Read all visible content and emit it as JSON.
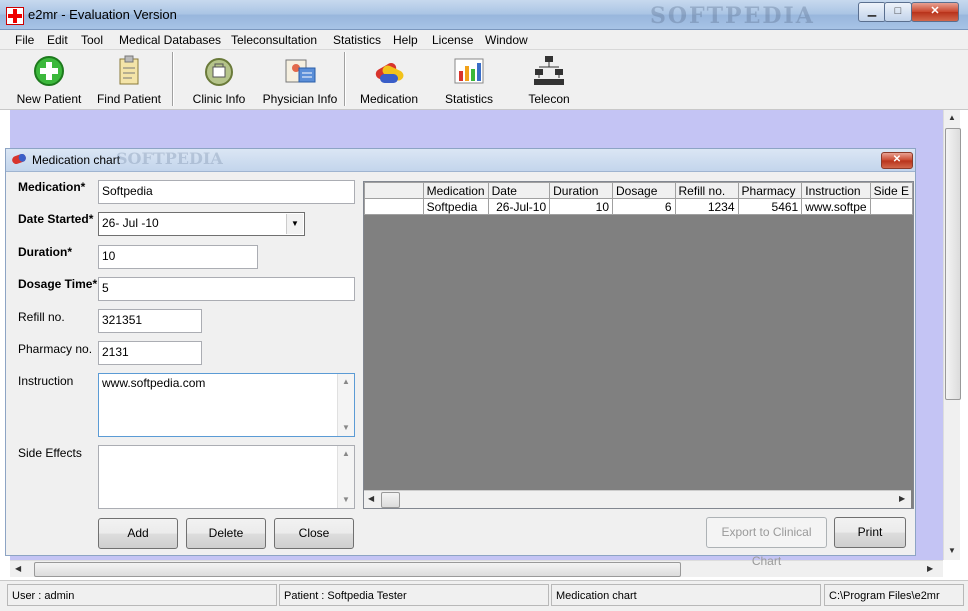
{
  "window": {
    "title": "e2mr - Evaluation Version",
    "watermark": "SOFTPEDIA",
    "min_glyph": "▁",
    "max_glyph": "□",
    "close_glyph": "✕"
  },
  "menu": [
    "File",
    "Edit",
    "Tool",
    "Medical Databases",
    "Teleconsultation",
    "Statistics",
    "Help",
    "License",
    "Window"
  ],
  "toolbar": [
    {
      "label": "New Patient",
      "icon": "new-patient-icon"
    },
    {
      "label": "Find Patient",
      "icon": "find-patient-icon"
    },
    {
      "label": "Clinic Info",
      "icon": "clinic-info-icon"
    },
    {
      "label": "Physician Info",
      "icon": "physician-info-icon"
    },
    {
      "label": "Medication",
      "icon": "medication-icon"
    },
    {
      "label": "Statistics",
      "icon": "statistics-icon"
    },
    {
      "label": "Telecon",
      "icon": "telecon-icon"
    }
  ],
  "child": {
    "title": "Medication chart",
    "watermark": "SOFTPEDIA",
    "close_glyph": "✕",
    "form": {
      "medication_label": "Medication*",
      "medication_value": "Softpedia",
      "date_label": "Date Started*",
      "date_value": "26- Jul -10",
      "duration_label": "Duration*",
      "duration_value": "10",
      "dosage_label": "Dosage Time*",
      "dosage_value": "5",
      "refill_label": "Refill no.",
      "refill_value": "321351",
      "pharmacy_label": "Pharmacy no.",
      "pharmacy_value": "2131",
      "instruction_label": "Instruction",
      "instruction_value": "www.softpedia.com",
      "side_effects_label": "Side Effects",
      "side_effects_value": ""
    },
    "buttons": {
      "add": "Add",
      "delete": "Delete",
      "close": "Close",
      "export": "Export to Clinical Chart",
      "print": "Print"
    },
    "grid": {
      "headers": [
        "",
        "Medication",
        "Date",
        "Duration",
        "Dosage",
        "Refill no.",
        "Pharmacy",
        "Instruction",
        "Side E"
      ],
      "rows": [
        [
          "",
          "Softpedia",
          "26-Jul-10",
          "10",
          "6",
          "1234",
          "5461",
          "www.softpe",
          ""
        ]
      ]
    }
  },
  "status": {
    "user": "User : admin",
    "patient": "Patient : Softpedia  Tester",
    "form": "Medication chart",
    "path": "C:\\Program Files\\e2mr"
  },
  "colors": {
    "mdi_background": "#c4c4f4",
    "grid_background": "#808080"
  }
}
